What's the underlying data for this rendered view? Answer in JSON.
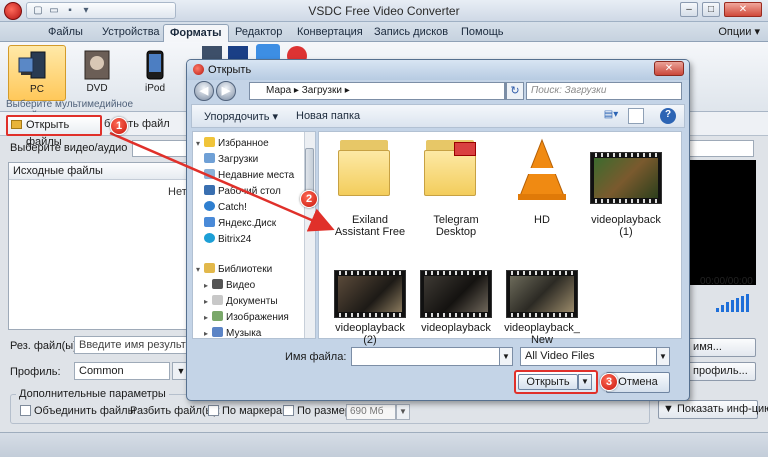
{
  "app": {
    "title": "VSDC Free Video Converter",
    "menu_tabs": [
      "Файлы",
      "Устройства",
      "Форматы",
      "Редактор",
      "Конвертация",
      "Запись дисков",
      "Помощь"
    ],
    "active_tab": "Форматы",
    "options": "Опции ▾",
    "devices": [
      "PC",
      "DVD",
      "iPod"
    ],
    "ribbon_hint": "Выберите мультимедийное устройство",
    "open_files": "Открыть файлы",
    "add_files": "бавить файл",
    "select_label": "Выберите видео/аудио",
    "files_header": "Исходные файлы",
    "no_files": "Нет",
    "time": "00:00/00:00",
    "result_label": "Рез. файл(ы):",
    "result_placeholder": "Введите имя результирую",
    "profile_label": "Профиль:",
    "profile_value": "Common",
    "change_name_btn": "нить имя...",
    "change_profile_btn": "нить профиль...",
    "extra_params": "Дополнительные параметры",
    "merge_files": "Объединить файлы",
    "split_files": "Разбить файл(ы):",
    "by_markers": "По маркерам",
    "by_size": "По размеру:",
    "size_value": "690 Мб",
    "show_info": "▼ Показать инф-цию"
  },
  "dialog": {
    "title": "Открыть",
    "address": [
      "Мара",
      "Загрузки"
    ],
    "search_placeholder": "Поиск: Загрузки",
    "organize": "Упорядочить ▾",
    "new_folder": "Новая папка",
    "nav_items": [
      {
        "label": "Избранное",
        "icon": "star-icon"
      },
      {
        "label": "Загрузки",
        "icon": "downloads-icon"
      },
      {
        "label": "Недавние места",
        "icon": "recent-icon"
      },
      {
        "label": "Рабочий стол",
        "icon": "desktop-icon"
      },
      {
        "label": "Catch!",
        "icon": "catch-icon"
      },
      {
        "label": "Яндекс.Диск",
        "icon": "yandex-disk-icon"
      },
      {
        "label": "Bitrix24",
        "icon": "bitrix-icon"
      },
      {
        "label": "Библиотеки",
        "icon": "libraries-icon"
      },
      {
        "label": "Видео",
        "icon": "video-library-icon"
      },
      {
        "label": "Документы",
        "icon": "documents-icon"
      },
      {
        "label": "Изображения",
        "icon": "images-icon"
      },
      {
        "label": "Музыка",
        "icon": "music-icon"
      }
    ],
    "files": [
      {
        "name": "Exiland Assistant Free",
        "kind": "folder"
      },
      {
        "name": "Telegram Desktop",
        "kind": "folder"
      },
      {
        "name": "HD",
        "kind": "vlc"
      },
      {
        "name": "videoplayback (1)",
        "kind": "video"
      },
      {
        "name": "videoplayback (2)",
        "kind": "video"
      },
      {
        "name": "videoplayback",
        "kind": "video"
      },
      {
        "name": "videoplayback_New",
        "kind": "video"
      }
    ],
    "filename_label": "Имя файла:",
    "filename_value": "",
    "filter": "All Video Files",
    "open_btn": "Открыть",
    "cancel_btn": "Отмена"
  },
  "annotations": [
    "1",
    "2",
    "3"
  ],
  "colors": {
    "highlight": "#e0302a",
    "accent": "#2c64b4"
  }
}
